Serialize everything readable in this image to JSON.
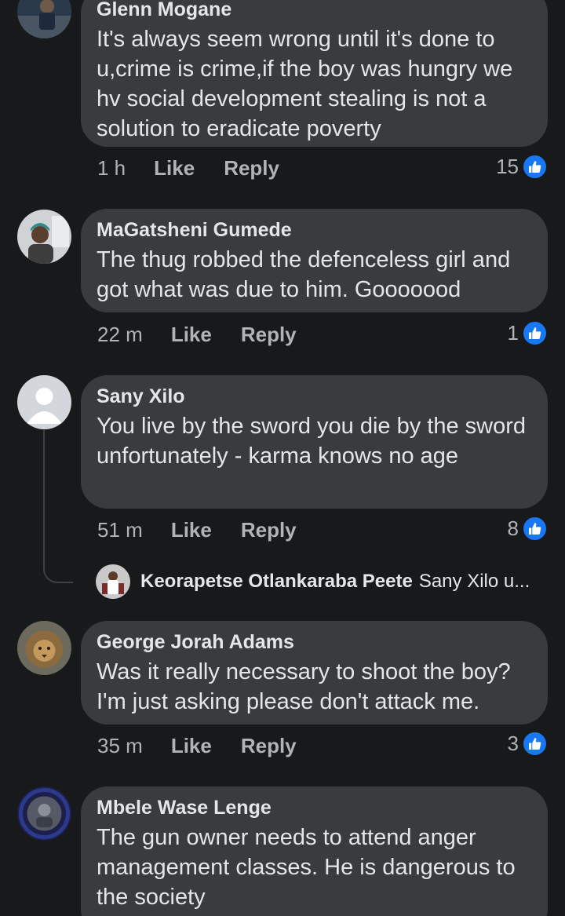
{
  "comments": [
    {
      "author": "Glenn Mogane",
      "text": "It's always seem wrong until it's done to u,crime is crime,if the boy was hungry we hv social development stealing is not a solution to eradicate poverty",
      "time": "1 h",
      "like_label": "Like",
      "reply_label": "Reply",
      "reaction_count": "15",
      "avatar_icon": "person-photo-avatar"
    },
    {
      "author": "MaGatsheni Gumede",
      "text": "The thug robbed the defenceless girl and got what was due to him. Gooooood",
      "time": "22 m",
      "like_label": "Like",
      "reply_label": "Reply",
      "reaction_count": "1",
      "avatar_icon": "person-photo-avatar"
    },
    {
      "author": "Sany Xilo",
      "text": "You live by the sword you die by the sword unfortunately - karma knows no age",
      "time": "51 m",
      "like_label": "Like",
      "reply_label": "Reply",
      "reaction_count": "8",
      "avatar_icon": "default-silhouette-avatar"
    },
    {
      "author": "George Jorah Adams",
      "text": "Was it really necessary to shoot the boy? I'm just asking please don't attack me.",
      "time": "35 m",
      "like_label": "Like",
      "reply_label": "Reply",
      "reaction_count": "3",
      "avatar_icon": "lion-avatar"
    },
    {
      "author": "Mbele Wase Lenge",
      "text": "The gun owner needs to attend anger management classes. He is dangerous to the society",
      "avatar_icon": "profile-frame-avatar"
    }
  ],
  "reply_preview": {
    "author": "Keorapetse Otlankaraba Peete",
    "snippet": "Sany Xilo u..."
  },
  "colors": {
    "background": "#18191a",
    "bubble": "#3a3b3c",
    "text": "#e4e6eb",
    "secondary_text": "#b0b3b8",
    "like_blue": "#1877f2"
  }
}
